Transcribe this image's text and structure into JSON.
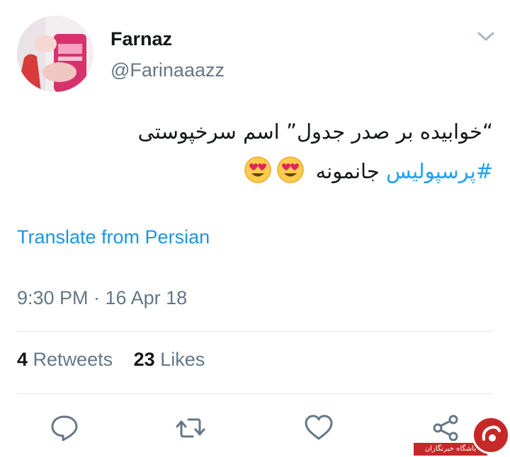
{
  "user": {
    "display_name": "Farnaz",
    "handle": "@Farinaaazz"
  },
  "tweet": {
    "line1": "“خوابیده بر صدر جدول” اسم سرخپوستی",
    "hashtag": "#پرسپولیس",
    "line2_suffix": " جانمونه ",
    "emoji_count": 2
  },
  "translate_label": "Translate from Persian",
  "timestamp": "9:30 PM · 16 Apr 18",
  "stats": {
    "retweets_count": "4",
    "retweets_label": "Retweets",
    "likes_count": "23",
    "likes_label": "Likes"
  },
  "actions": [
    "reply-icon",
    "retweet-icon",
    "like-icon",
    "share-icon"
  ],
  "watermark_text": "باشگاه خبرنگاران",
  "colors": {
    "link": "#1b95e0",
    "hashtag": "#1da1f2",
    "secondary_text": "#657786",
    "primary_text": "#14171a",
    "divider": "#e1e8ed",
    "watermark": "#c62828"
  }
}
